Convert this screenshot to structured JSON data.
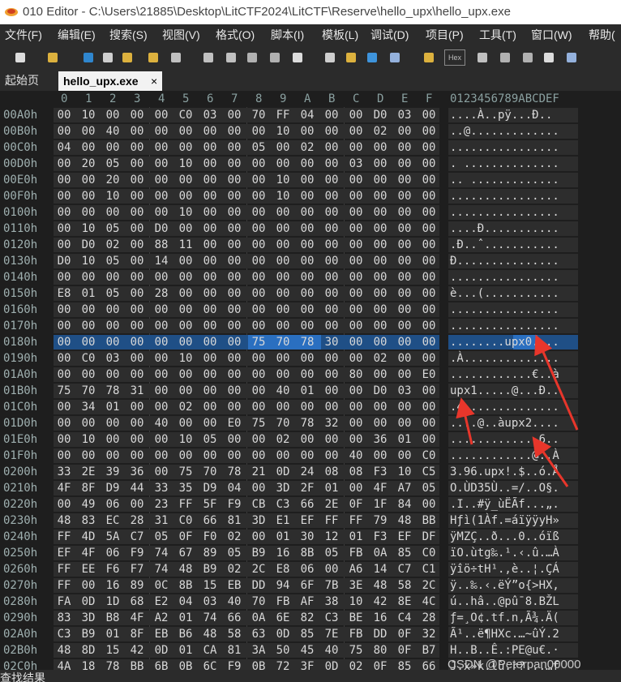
{
  "window": {
    "title": "010 Editor - C:\\Users\\21885\\Desktop\\LitCTF2024\\LitCTF\\Reserve\\hello_upx\\hello_upx.exe"
  },
  "menu": [
    "文件(F)",
    "编辑(E)",
    "搜索(S)",
    "视图(V)",
    "格式(O)",
    "脚本(I)",
    "模板(L)",
    "调试(D)",
    "项目(P)",
    "工具(T)",
    "窗口(W)",
    "帮助("
  ],
  "toolbar": {
    "icons": [
      "new-file-icon",
      "open-file-icon",
      "save-icon",
      "save-all-icon",
      "open-folder-icon",
      "open-project-icon",
      "cut-icon",
      "copy-icon",
      "paste-icon",
      "undo-icon",
      "redo-icon",
      "find-icon",
      "replace-icon",
      "find-in-files-icon",
      "goto-icon",
      "compare-icon",
      "checksum-icon",
      "hex-mode-icon",
      "text-mode-icon",
      "show-whitespace-icon",
      "columns-icon",
      "highlight-icon",
      "calculator-icon"
    ],
    "hex_label": "Hex"
  },
  "tabs": {
    "start": "起始页",
    "file": "hello_upx.exe",
    "close": "×"
  },
  "header": {
    "columns": [
      "0",
      "1",
      "2",
      "3",
      "4",
      "5",
      "6",
      "7",
      "8",
      "9",
      "A",
      "B",
      "C",
      "D",
      "E",
      "F"
    ],
    "ascii": "0123456789ABCDEF"
  },
  "rows": [
    {
      "addr": "00A0h",
      "hex": [
        "00",
        "10",
        "00",
        "00",
        "00",
        "C0",
        "03",
        "00",
        "70",
        "FF",
        "04",
        "00",
        "00",
        "D0",
        "03",
        "00"
      ],
      "ascii": "....À..pÿ...Ð.."
    },
    {
      "addr": "00B0h",
      "hex": [
        "00",
        "00",
        "40",
        "00",
        "00",
        "00",
        "00",
        "00",
        "00",
        "10",
        "00",
        "00",
        "00",
        "02",
        "00",
        "00"
      ],
      "ascii": "..@............."
    },
    {
      "addr": "00C0h",
      "hex": [
        "04",
        "00",
        "00",
        "00",
        "00",
        "00",
        "00",
        "00",
        "05",
        "00",
        "02",
        "00",
        "00",
        "00",
        "00",
        "00"
      ],
      "ascii": "................"
    },
    {
      "addr": "00D0h",
      "hex": [
        "00",
        "20",
        "05",
        "00",
        "00",
        "10",
        "00",
        "00",
        "00",
        "00",
        "00",
        "00",
        "03",
        "00",
        "00",
        "00"
      ],
      "ascii": ". .............."
    },
    {
      "addr": "00E0h",
      "hex": [
        "00",
        "00",
        "20",
        "00",
        "00",
        "00",
        "00",
        "00",
        "00",
        "10",
        "00",
        "00",
        "00",
        "00",
        "00",
        "00"
      ],
      "ascii": ".. ............."
    },
    {
      "addr": "00F0h",
      "hex": [
        "00",
        "00",
        "10",
        "00",
        "00",
        "00",
        "00",
        "00",
        "00",
        "10",
        "00",
        "00",
        "00",
        "00",
        "00",
        "00"
      ],
      "ascii": "................"
    },
    {
      "addr": "0100h",
      "hex": [
        "00",
        "00",
        "00",
        "00",
        "00",
        "10",
        "00",
        "00",
        "00",
        "00",
        "00",
        "00",
        "00",
        "00",
        "00",
        "00"
      ],
      "ascii": "................"
    },
    {
      "addr": "0110h",
      "hex": [
        "00",
        "10",
        "05",
        "00",
        "D0",
        "00",
        "00",
        "00",
        "00",
        "00",
        "00",
        "00",
        "00",
        "00",
        "00",
        "00"
      ],
      "ascii": "....Ð..........."
    },
    {
      "addr": "0120h",
      "hex": [
        "00",
        "D0",
        "02",
        "00",
        "88",
        "11",
        "00",
        "00",
        "00",
        "00",
        "00",
        "00",
        "00",
        "00",
        "00",
        "00"
      ],
      "ascii": ".Ð..ˆ..........."
    },
    {
      "addr": "0130h",
      "hex": [
        "D0",
        "10",
        "05",
        "00",
        "14",
        "00",
        "00",
        "00",
        "00",
        "00",
        "00",
        "00",
        "00",
        "00",
        "00",
        "00"
      ],
      "ascii": "Ð..............."
    },
    {
      "addr": "0140h",
      "hex": [
        "00",
        "00",
        "00",
        "00",
        "00",
        "00",
        "00",
        "00",
        "00",
        "00",
        "00",
        "00",
        "00",
        "00",
        "00",
        "00"
      ],
      "ascii": "................"
    },
    {
      "addr": "0150h",
      "hex": [
        "E8",
        "01",
        "05",
        "00",
        "28",
        "00",
        "00",
        "00",
        "00",
        "00",
        "00",
        "00",
        "00",
        "00",
        "00",
        "00"
      ],
      "ascii": "è...(..........."
    },
    {
      "addr": "0160h",
      "hex": [
        "00",
        "00",
        "00",
        "00",
        "00",
        "00",
        "00",
        "00",
        "00",
        "00",
        "00",
        "00",
        "00",
        "00",
        "00",
        "00"
      ],
      "ascii": "................"
    },
    {
      "addr": "0170h",
      "hex": [
        "00",
        "00",
        "00",
        "00",
        "00",
        "00",
        "00",
        "00",
        "00",
        "00",
        "00",
        "00",
        "00",
        "00",
        "00",
        "00"
      ],
      "ascii": "................"
    },
    {
      "addr": "0180h",
      "hex": [
        "00",
        "00",
        "00",
        "00",
        "00",
        "00",
        "00",
        "00",
        "75",
        "70",
        "78",
        "30",
        "00",
        "00",
        "00",
        "00"
      ],
      "ascii": "........upx0....",
      "selected": true
    },
    {
      "addr": "0190h",
      "hex": [
        "00",
        "C0",
        "03",
        "00",
        "00",
        "10",
        "00",
        "00",
        "00",
        "00",
        "00",
        "00",
        "00",
        "02",
        "00",
        "00"
      ],
      "ascii": ".À.............."
    },
    {
      "addr": "01A0h",
      "hex": [
        "00",
        "00",
        "00",
        "00",
        "00",
        "00",
        "00",
        "00",
        "00",
        "00",
        "00",
        "00",
        "80",
        "00",
        "00",
        "E0"
      ],
      "ascii": "............€..à"
    },
    {
      "addr": "01B0h",
      "hex": [
        "75",
        "70",
        "78",
        "31",
        "00",
        "00",
        "00",
        "00",
        "00",
        "40",
        "01",
        "00",
        "00",
        "D0",
        "03",
        "00"
      ],
      "ascii": "upx1.....@...Ð.."
    },
    {
      "addr": "01C0h",
      "hex": [
        "00",
        "34",
        "01",
        "00",
        "00",
        "02",
        "00",
        "00",
        "00",
        "00",
        "00",
        "00",
        "00",
        "00",
        "00",
        "00"
      ],
      "ascii": ".4.............."
    },
    {
      "addr": "01D0h",
      "hex": [
        "00",
        "00",
        "00",
        "00",
        "40",
        "00",
        "00",
        "E0",
        "75",
        "70",
        "78",
        "32",
        "00",
        "00",
        "00",
        "00"
      ],
      "ascii": "....@..àupx2...."
    },
    {
      "addr": "01E0h",
      "hex": [
        "00",
        "10",
        "00",
        "00",
        "00",
        "10",
        "05",
        "00",
        "00",
        "02",
        "00",
        "00",
        "00",
        "36",
        "01",
        "00"
      ],
      "ascii": ".............6.."
    },
    {
      "addr": "01F0h",
      "hex": [
        "00",
        "00",
        "00",
        "00",
        "00",
        "00",
        "00",
        "00",
        "00",
        "00",
        "00",
        "00",
        "40",
        "00",
        "00",
        "C0"
      ],
      "ascii": "............@..À"
    },
    {
      "addr": "0200h",
      "hex": [
        "33",
        "2E",
        "39",
        "36",
        "00",
        "75",
        "70",
        "78",
        "21",
        "0D",
        "24",
        "08",
        "08",
        "F3",
        "10",
        "C5"
      ],
      "ascii": "3.96.upx!.$..ó.Å"
    },
    {
      "addr": "0210h",
      "hex": [
        "4F",
        "8F",
        "D9",
        "44",
        "33",
        "35",
        "D9",
        "04",
        "00",
        "3D",
        "2F",
        "01",
        "00",
        "4F",
        "A7",
        "05"
      ],
      "ascii": "O.ÙD35Ù..=/..O§."
    },
    {
      "addr": "0220h",
      "hex": [
        "00",
        "49",
        "06",
        "00",
        "23",
        "FF",
        "5F",
        "F9",
        "CB",
        "C3",
        "66",
        "2E",
        "0F",
        "1F",
        "84",
        "00"
      ],
      "ascii": ".I..#ÿ_ùËÃf...„."
    },
    {
      "addr": "0230h",
      "hex": [
        "48",
        "83",
        "EC",
        "28",
        "31",
        "C0",
        "66",
        "81",
        "3D",
        "E1",
        "EF",
        "FF",
        "FF",
        "79",
        "48",
        "BB"
      ],
      "ascii": "Hƒì(1Àf.=áïÿÿyH»"
    },
    {
      "addr": "0240h",
      "hex": [
        "FF",
        "4D",
        "5A",
        "C7",
        "05",
        "0F",
        "F0",
        "02",
        "00",
        "01",
        "30",
        "12",
        "01",
        "F3",
        "EF",
        "DF"
      ],
      "ascii": "ÿMZÇ..ð...0..óïß"
    },
    {
      "addr": "0250h",
      "hex": [
        "EF",
        "4F",
        "06",
        "F9",
        "74",
        "67",
        "89",
        "05",
        "B9",
        "16",
        "8B",
        "05",
        "FB",
        "0A",
        "85",
        "C0"
      ],
      "ascii": "ïO.ùtg‰.¹.‹.û.…À"
    },
    {
      "addr": "0260h",
      "hex": [
        "FF",
        "EE",
        "F6",
        "F7",
        "74",
        "48",
        "B9",
        "02",
        "2C",
        "E8",
        "06",
        "00",
        "A6",
        "14",
        "C7",
        "C1"
      ],
      "ascii": "ÿîö÷tH¹.,è..¦.ÇÁ"
    },
    {
      "addr": "0270h",
      "hex": [
        "FF",
        "00",
        "16",
        "89",
        "0C",
        "8B",
        "15",
        "EB",
        "DD",
        "94",
        "6F",
        "7B",
        "3E",
        "48",
        "58",
        "2C"
      ],
      "ascii": "ÿ..‰.‹.ëÝ”o{>HX,"
    },
    {
      "addr": "0280h",
      "hex": [
        "FA",
        "0D",
        "1D",
        "68",
        "E2",
        "04",
        "03",
        "40",
        "70",
        "FB",
        "AF",
        "38",
        "10",
        "42",
        "8E",
        "4C"
      ],
      "ascii": "ú..hâ..@pû¯8.BŽL"
    },
    {
      "addr": "0290h",
      "hex": [
        "83",
        "3D",
        "B8",
        "4F",
        "A2",
        "01",
        "74",
        "66",
        "0A",
        "6E",
        "82",
        "C3",
        "BE",
        "16",
        "C4",
        "28"
      ],
      "ascii": "ƒ=¸O¢.tf.n‚Ã¾.Ä("
    },
    {
      "addr": "02A0h",
      "hex": [
        "C3",
        "B9",
        "01",
        "8F",
        "EB",
        "B6",
        "48",
        "58",
        "63",
        "0D",
        "85",
        "7E",
        "FB",
        "DD",
        "0F",
        "32"
      ],
      "ascii": "Ã¹..ë¶HXc.…~ûÝ.2"
    },
    {
      "addr": "02B0h",
      "hex": [
        "48",
        "8D",
        "15",
        "42",
        "0D",
        "01",
        "CA",
        "81",
        "3A",
        "50",
        "45",
        "40",
        "75",
        "80",
        "0F",
        "B7"
      ],
      "ascii": "H..B..Ê.:PE@u€.·"
    },
    {
      "addr": "02C0h",
      "hex": [
        "4A",
        "18",
        "78",
        "BB",
        "6B",
        "0B",
        "6C",
        "F9",
        "0B",
        "72",
        "3F",
        "0D",
        "02",
        "0F",
        "85",
        "66"
      ],
      "ascii": "J.x»k.lù.r?...…f"
    }
  ],
  "selection": {
    "row": 14,
    "highlight_bytes": [
      8,
      10
    ],
    "highlight_ascii": "upx"
  },
  "status": "查找结果",
  "watermark": "CSDN @Peterpan00000",
  "colors": {
    "background": "#1e1e1e",
    "band": "#2d2d2d",
    "selection": "#1f4f86",
    "selection_highlight": "#2a6fc0",
    "arrow": "#e8362b"
  }
}
